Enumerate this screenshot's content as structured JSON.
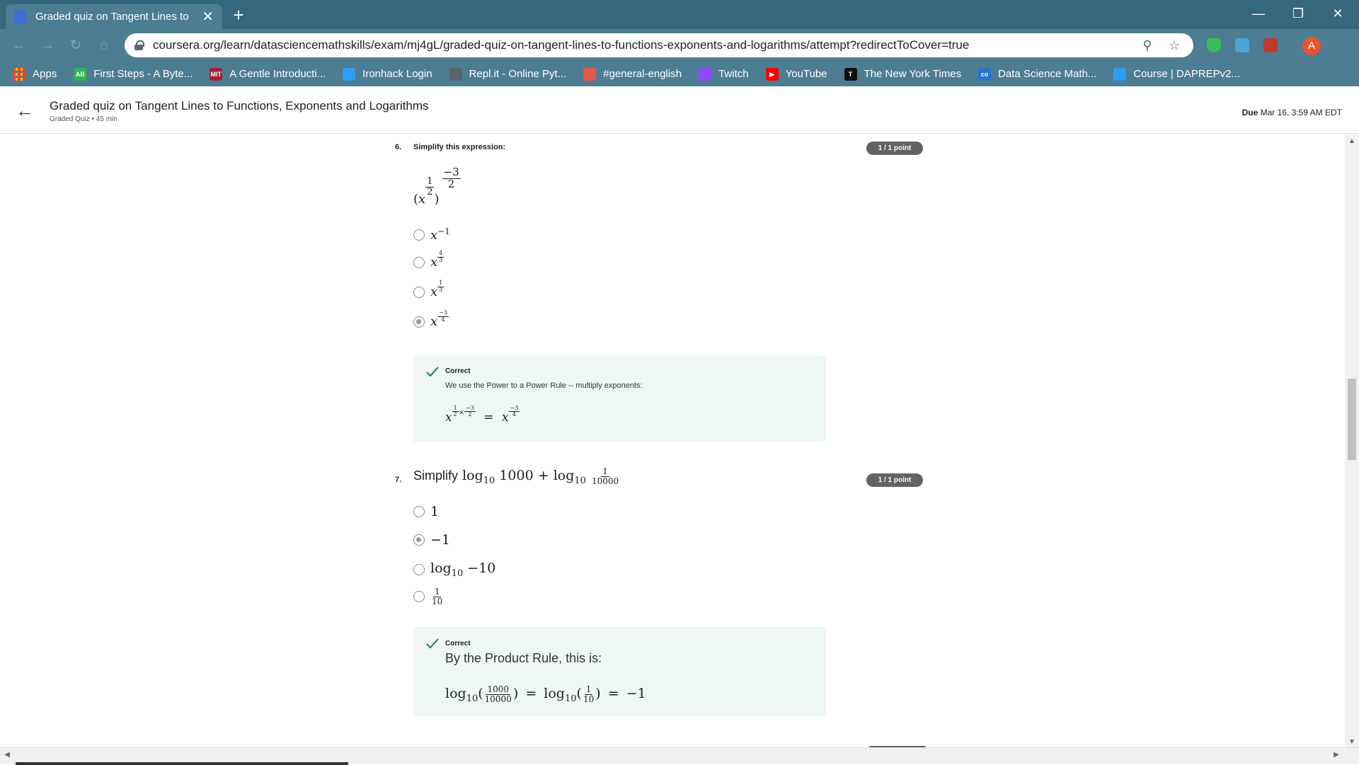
{
  "browser": {
    "tab_title": "Graded quiz on Tangent Lines to",
    "new_tab": "+",
    "url": "coursera.org/learn/datasciencemathskills/exam/mj4gL/graded-quiz-on-tangent-lines-to-functions-exponents-and-logarithms/attempt?redirectToCover=true",
    "avatar_letter": "A",
    "window": {
      "minimize": "—",
      "restore": "❐",
      "close": "✕"
    },
    "bookmarks": [
      {
        "label": "Apps",
        "color": "#4285f4",
        "icon": "apps-grid-icon",
        "glyph": ""
      },
      {
        "label": "First Steps - A Byte...",
        "color": "#2db84d",
        "icon": "ab-icon",
        "glyph": "AB"
      },
      {
        "label": "A Gentle Introducti...",
        "color": "#a31f34",
        "icon": "mit-ocw-icon",
        "glyph": "MIT"
      },
      {
        "label": "Ironhack Login",
        "color": "#2f9df2",
        "icon": "ironhack-icon",
        "glyph": ""
      },
      {
        "label": "Repl.it - Online Pyt...",
        "color": "#5a6270",
        "icon": "replit-icon",
        "glyph": ""
      },
      {
        "label": "#general-english",
        "color": "#e8574b",
        "icon": "discord-icon",
        "glyph": ""
      },
      {
        "label": "Twitch",
        "color": "#9146ff",
        "icon": "twitch-icon",
        "glyph": ""
      },
      {
        "label": "YouTube",
        "color": "#ff0000",
        "icon": "youtube-icon",
        "glyph": "▶"
      },
      {
        "label": "The New York Times",
        "color": "#111111",
        "icon": "nyt-icon",
        "glyph": "T"
      },
      {
        "label": "Data Science Math...",
        "color": "#2a73cc",
        "icon": "coursera-icon",
        "glyph": "co"
      },
      {
        "label": "Course | DAPREPv2...",
        "color": "#2f9df2",
        "icon": "ironhack-icon",
        "glyph": ""
      }
    ]
  },
  "header": {
    "title": "Graded quiz on Tangent Lines to Functions, Exponents and Logarithms",
    "subtitle": "Graded Quiz • 45 min",
    "due_label": "Due",
    "due_value": "Mar 16, 3:59 AM EDT"
  },
  "questions": [
    {
      "number": "6.",
      "prompt": "Simplify this expression:",
      "points": "1 / 1 point",
      "expression": {
        "base": "x",
        "inner_num": "1",
        "inner_den": "2",
        "outer_num": "−3",
        "outer_den": "2"
      },
      "options": [
        {
          "base": "x",
          "exp": "−1",
          "selected": false
        },
        {
          "base": "x",
          "exp_num": "4",
          "exp_den": "3",
          "selected": false
        },
        {
          "base": "x",
          "exp_num": "1",
          "exp_den": "3",
          "selected": false
        },
        {
          "base": "x",
          "exp_num": "−3",
          "exp_den": "4",
          "selected": true
        }
      ],
      "feedback": {
        "label": "Correct",
        "text": "We use the Power to a Power Rule -- multiply exponents:",
        "lhs_base": "x",
        "lhs_n1": "1",
        "lhs_d1": "2",
        "times": "×",
        "lhs_n2": "−3",
        "lhs_d2": "2",
        "equals": "=",
        "rhs_base": "x",
        "rhs_n": "−3",
        "rhs_d": "4"
      }
    },
    {
      "number": "7.",
      "prompt_word": "Simplify",
      "log": "log",
      "sub": "10",
      "prompt_arg1": "1000",
      "plus": "+",
      "prompt_num": "1",
      "prompt_den": "10000",
      "points": "1 / 1 point",
      "options": [
        {
          "text": "1",
          "selected": false
        },
        {
          "text": "−1",
          "selected": true
        },
        {
          "text": "−10",
          "selected": false
        },
        {
          "num": "1",
          "den": "10",
          "selected": false
        }
      ],
      "feedback": {
        "label": "Correct",
        "text": "By the Product Rule, this is:",
        "num1": "1000",
        "den1": "10000",
        "num2": "1",
        "den2": "10",
        "equals": "=",
        "result": "−1"
      }
    }
  ]
}
